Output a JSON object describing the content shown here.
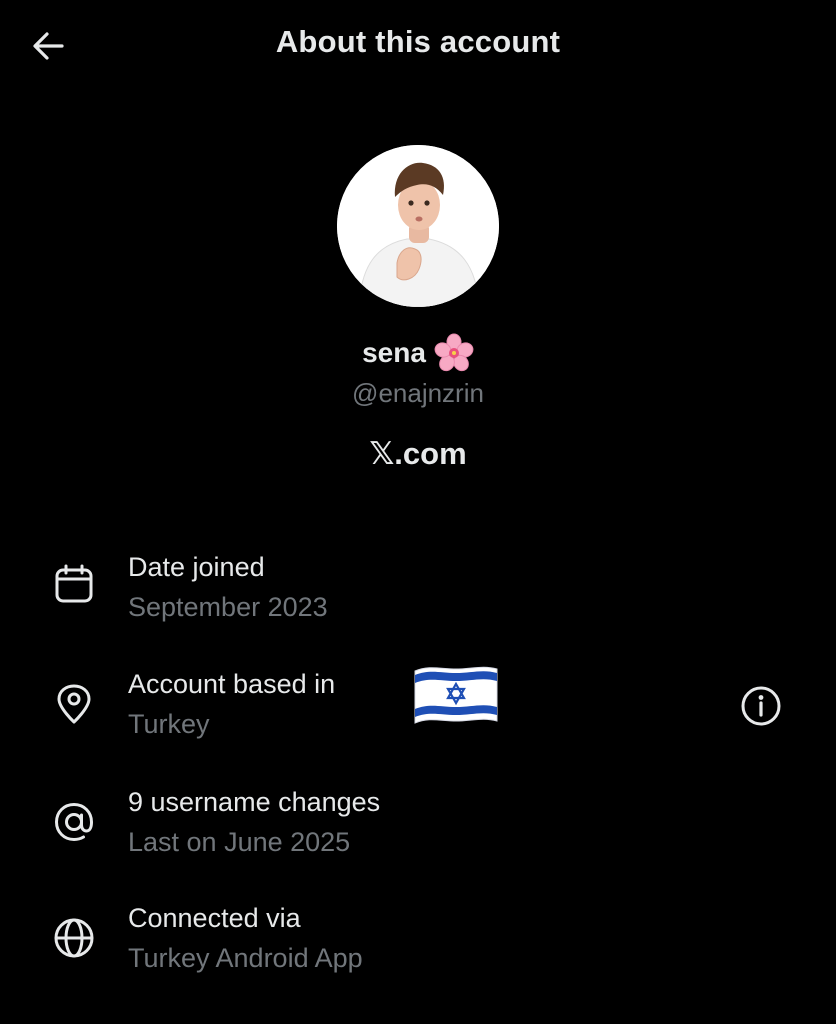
{
  "header": {
    "title": "About this account",
    "back_icon": "arrow-left-icon"
  },
  "profile": {
    "display_name": "sena",
    "name_emoji": "cherry-blossom-icon",
    "handle": "@enajnzrin",
    "site": "𝕏.com"
  },
  "rows": [
    {
      "icon": "calendar-icon",
      "title": "Date joined",
      "subtitle": "September 2023"
    },
    {
      "icon": "location-pin-icon",
      "title": "Account based in",
      "subtitle": "Turkey",
      "extra_icon": "israel-flag-icon",
      "action_icon": "info-icon"
    },
    {
      "icon": "at-sign-icon",
      "title": "9 username changes",
      "subtitle": "Last on June 2025"
    },
    {
      "icon": "globe-icon",
      "title": "Connected via",
      "subtitle": "Turkey Android App"
    }
  ],
  "colors": {
    "background": "#000000",
    "primary_text": "#e7e9ea",
    "secondary_text": "#71767b",
    "flag_blue": "#1f4fb5"
  }
}
